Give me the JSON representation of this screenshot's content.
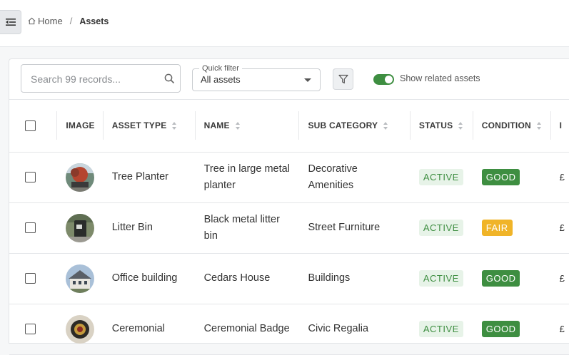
{
  "breadcrumb": {
    "home": "Home",
    "separator": "/",
    "current": "Assets"
  },
  "toolbar": {
    "search_placeholder": "Search 99 records...",
    "quick_filter_label": "Quick filter",
    "quick_filter_value": "All assets",
    "toggle_label": "Show related assets",
    "toggle_on": true
  },
  "columns": {
    "image": "IMAGE",
    "asset_type": "ASSET TYPE",
    "name": "NAME",
    "sub_category": "SUB CATEGORY",
    "status": "STATUS",
    "condition": "CONDITION",
    "cut": "I"
  },
  "rows": [
    {
      "asset_type": "Tree Planter",
      "name": "Tree in large metal planter",
      "sub_category": "Decorative Amenities",
      "status": "ACTIVE",
      "condition": "GOOD",
      "condition_color": "#3e8e41",
      "cut": "£"
    },
    {
      "asset_type": "Litter Bin",
      "name": "Black metal litter bin",
      "sub_category": "Street Furniture",
      "status": "ACTIVE",
      "condition": "FAIR",
      "condition_color": "#f0b428",
      "cut": "£"
    },
    {
      "asset_type": "Office building",
      "name": "Cedars House",
      "sub_category": "Buildings",
      "status": "ACTIVE",
      "condition": "GOOD",
      "condition_color": "#3e8e41",
      "cut": "£"
    },
    {
      "asset_type": "Ceremonial",
      "name": "Ceremonial Badge",
      "sub_category": "Civic Regalia",
      "status": "ACTIVE",
      "condition": "GOOD",
      "condition_color": "#3e8e41",
      "cut": "£"
    }
  ],
  "colors": {
    "accent_green": "#3e8e41",
    "warning_yellow": "#f0b428"
  }
}
